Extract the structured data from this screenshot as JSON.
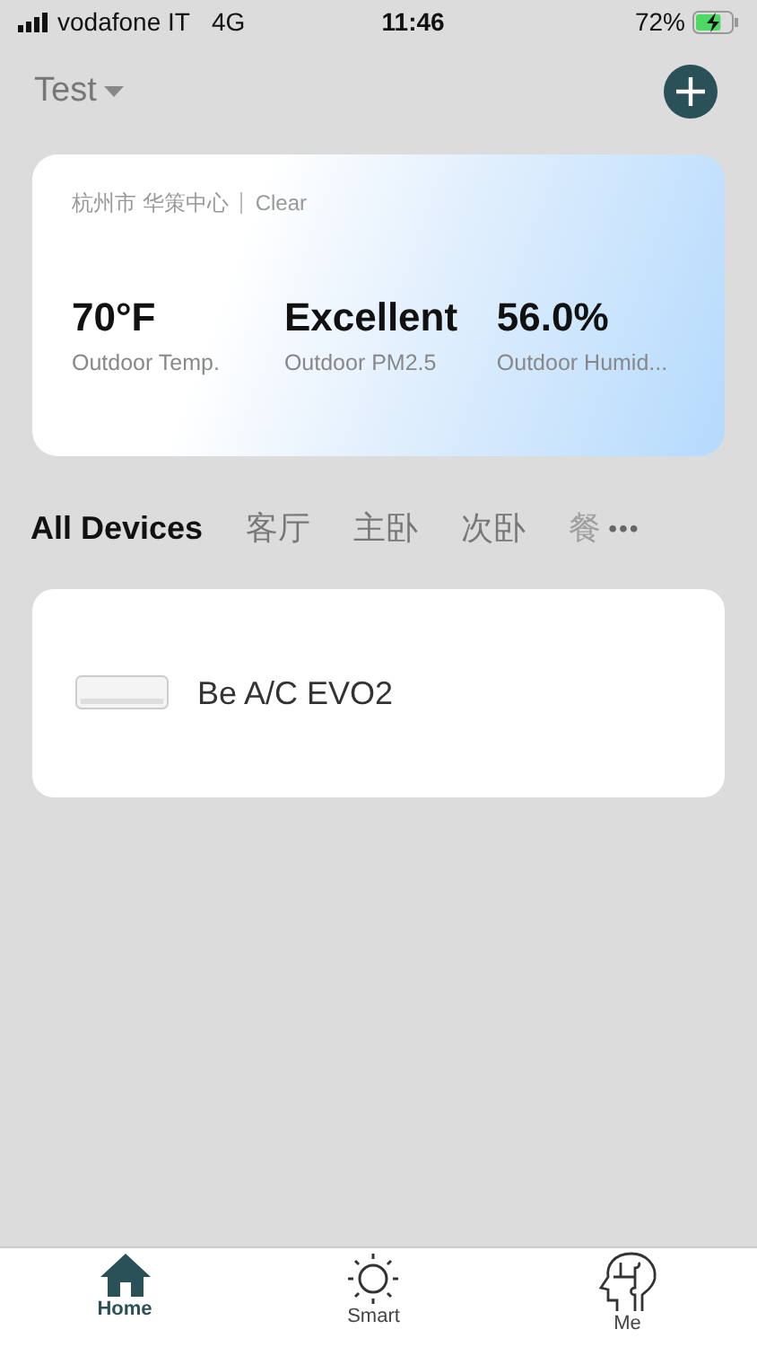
{
  "status_bar": {
    "carrier": "vodafone IT",
    "network": "4G",
    "time": "11:46",
    "battery": "72%",
    "charging": true
  },
  "header": {
    "home_name": "Test"
  },
  "weather": {
    "location": "杭州市 华策中心",
    "condition": "Clear",
    "stats": [
      {
        "value": "70°F",
        "label": "Outdoor Temp."
      },
      {
        "value": "Excellent",
        "label": "Outdoor PM2.5"
      },
      {
        "value": "56.0%",
        "label": "Outdoor Humid..."
      }
    ]
  },
  "rooms": [
    {
      "label": "All Devices",
      "selected": true
    },
    {
      "label": "客厅",
      "selected": false
    },
    {
      "label": "主卧",
      "selected": false
    },
    {
      "label": "次卧",
      "selected": false
    },
    {
      "label": "餐",
      "selected": false
    }
  ],
  "more": "•••",
  "devices": [
    {
      "name": "Be A/C EVO2"
    }
  ],
  "tab_bar": [
    {
      "kind": "home",
      "label": "Home",
      "selected": true
    },
    {
      "kind": "smart",
      "label": "Smart",
      "selected": false
    },
    {
      "kind": "me",
      "label": "Me",
      "selected": false
    }
  ]
}
